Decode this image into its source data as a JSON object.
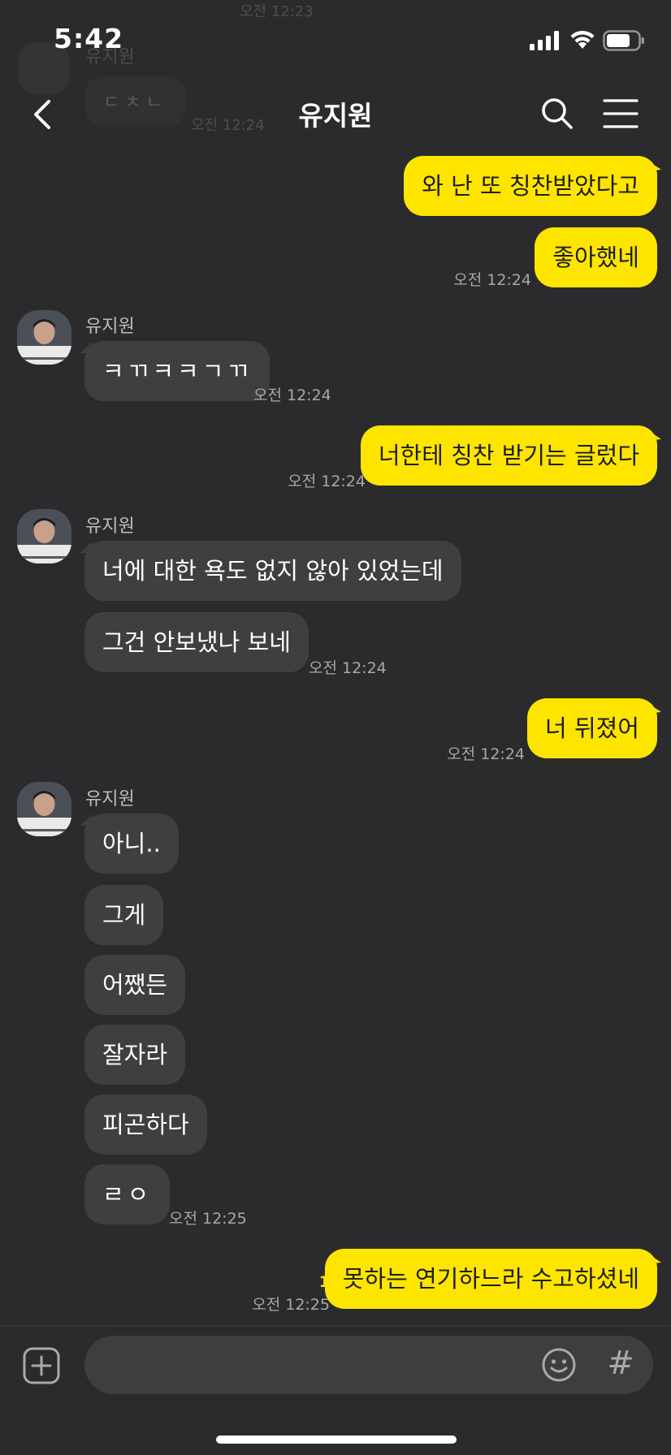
{
  "status_bar": {
    "time": "5:42"
  },
  "ghost": {
    "time_top": "오전 12:23",
    "name": "유지원",
    "bubble": "ㄷㅊㄴ",
    "time": "오전 12:24"
  },
  "header": {
    "title": "유지원",
    "icons": {
      "back": "chevron-left-icon",
      "search": "search-icon",
      "menu": "hamburger-menu-icon"
    }
  },
  "messages": [
    {
      "side": "out",
      "text": "와 난 또 칭찬받았다고"
    },
    {
      "side": "out",
      "text": "좋아했네",
      "time": "오전 12:24"
    },
    {
      "side": "in",
      "sender": "유지원",
      "text": "ㅋㄲㅋㅋㄱㄲ",
      "time": "오전 12:24"
    },
    {
      "side": "out",
      "text": "너한테 칭찬 받기는 글렀다",
      "time": "오전 12:24"
    },
    {
      "side": "in",
      "sender": "유지원",
      "text": "너에 대한 욕도 없지 않아 있었는데"
    },
    {
      "side": "in",
      "text": "그건 안보냈나 보네",
      "time": "오전 12:24"
    },
    {
      "side": "out",
      "text": "너 뒤졌어",
      "time": "오전 12:24"
    },
    {
      "side": "in",
      "sender": "유지원",
      "text": "아니.."
    },
    {
      "side": "in",
      "text": "그게"
    },
    {
      "side": "in",
      "text": "어쨌든"
    },
    {
      "side": "in",
      "text": "잘자라"
    },
    {
      "side": "in",
      "text": "피곤하다"
    },
    {
      "side": "in",
      "text": "ㄹㅇ",
      "time": "오전 12:25"
    },
    {
      "side": "out",
      "text": "못하는 연기하느라 수고하셨네",
      "time": "오전 12:25",
      "unread": "1"
    }
  ],
  "input_bar": {
    "placeholder": "",
    "hashtag": "#",
    "icons": {
      "add": "plus-square-icon",
      "emoji": "emoji-icon"
    }
  },
  "colors": {
    "background": "#2b2b2d",
    "outgoing_bubble": "#fee500",
    "incoming_bubble": "#3f3f41",
    "timestamp": "#a8a8a8"
  }
}
